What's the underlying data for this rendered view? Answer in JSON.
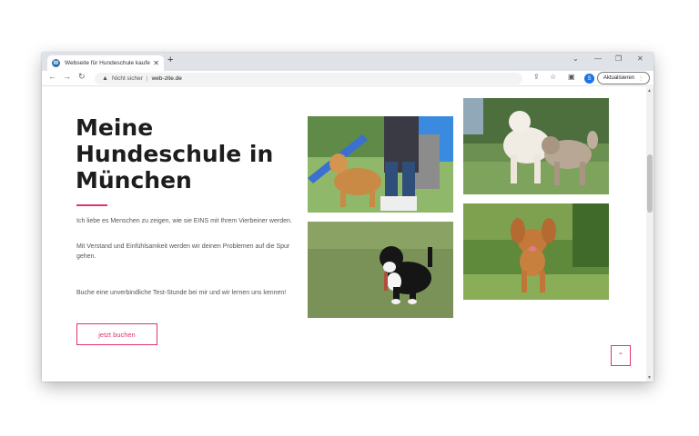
{
  "browser": {
    "tab_title": "Webseite für Hundeschule kaufen",
    "tab_icon": "wordpress-icon",
    "new_tab": "+",
    "security_label": "Nicht sicher",
    "url": "web-zite.de",
    "profile_initial": "S",
    "update_label": "Aktualisieren"
  },
  "hero": {
    "headline_lines": [
      "Meine",
      "Hundeschule in",
      "München"
    ],
    "paragraph1": "Ich liebe es Menschen zu zeigen, wie sie EINS mit Ihrem Vierbeiner werden.",
    "paragraph2": "Mit Verstand und Einfühlsamkeit werden wir deinen Problemen auf die Spur gehen.",
    "paragraph3": "Buche eine unverbindliche Test-Stunde bei mir und wir lernen uns kennen!",
    "button_label": "jetzt buchen",
    "accent_color": "#e0356c"
  },
  "photos": [
    {
      "name": "photo-golden-retriever-agility"
    },
    {
      "name": "photo-poodle-and-terrier"
    },
    {
      "name": "photo-puppy-on-lawn"
    },
    {
      "name": "photo-spaniel-running"
    }
  ]
}
